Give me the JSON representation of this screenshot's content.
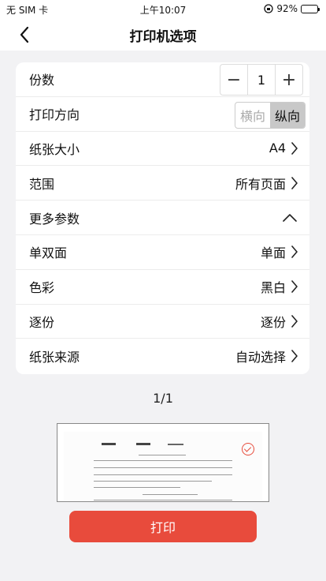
{
  "status_bar": {
    "carrier": "无 SIM 卡",
    "time": "上午10:07",
    "battery": "92%",
    "battery_level": 0.92
  },
  "nav": {
    "title": "打印机选项"
  },
  "options": {
    "copies": {
      "label": "份数",
      "minus": "−",
      "value": "1",
      "plus": "+"
    },
    "orientation": {
      "label": "打印方向",
      "landscape": "横向",
      "portrait": "纵向",
      "selected": "portrait"
    },
    "paper_size": {
      "label": "纸张大小",
      "value": "A4"
    },
    "range": {
      "label": "范围",
      "value": "所有页面"
    },
    "more": {
      "label": "更多参数",
      "expanded": true
    },
    "duplex": {
      "label": "单双面",
      "value": "单面"
    },
    "color": {
      "label": "色彩",
      "value": "黑白"
    },
    "collate": {
      "label": "逐份",
      "value": "逐份"
    },
    "source": {
      "label": "纸张来源",
      "value": "自动选择"
    }
  },
  "preview": {
    "page_indicator": "1/1",
    "selected": true
  },
  "actions": {
    "print_label": "打印"
  },
  "colors": {
    "accent": "#e84b3c",
    "background": "#f2f2f4"
  }
}
